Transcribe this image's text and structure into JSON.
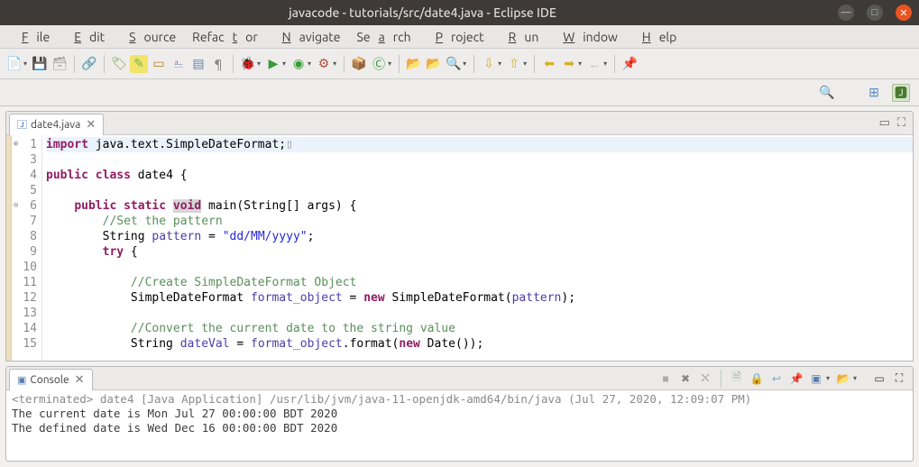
{
  "window": {
    "title": "javacode - tutorials/src/date4.java - Eclipse IDE"
  },
  "menu": {
    "file": "File",
    "edit": "Edit",
    "source": "Source",
    "refactor": "Refactor",
    "navigate": "Navigate",
    "search": "Search",
    "project": "Project",
    "run": "Run",
    "window": "Window",
    "help": "Help"
  },
  "editor": {
    "tab_filename": "date4.java",
    "tab_close": "✕",
    "gutter": {
      "l1": "1",
      "l3": "3",
      "l4": "4",
      "l5": "5",
      "l6": "6",
      "l7": "7",
      "l8": "8",
      "l9": "9",
      "l10": "10",
      "l11": "11",
      "l12": "12",
      "l13": "13",
      "l14": "14",
      "l15": "15"
    },
    "code": {
      "line1_import": "import",
      "line1_rest": " java.text.SimpleDateFormat;",
      "line1_box": "▯",
      "line3": "",
      "line4_public": "public",
      "line4_class": "class",
      "line4_rest": " date4 {",
      "line5": "",
      "line6_indent": "    ",
      "line6_public": "public",
      "line6_static": "static",
      "line6_void": "void",
      "line6_rest": " main(String[] args) {",
      "line7_indent": "        ",
      "line7_cm": "//Set the pattern",
      "line8_indent": "        ",
      "line8_a": "String ",
      "line8_var": "pattern",
      "line8_eq": " = ",
      "line8_str": "\"dd/MM/yyyy\"",
      "line8_end": ";",
      "line9_indent": "        ",
      "line9_try": "try",
      "line9_rest": " {",
      "line10": "",
      "line11_indent": "            ",
      "line11_cm": "//Create SimpleDateFormat Object",
      "line12_indent": "            ",
      "line12_a": "SimpleDateFormat ",
      "line12_var": "format_object",
      "line12_eq": " = ",
      "line12_new": "new",
      "line12_b": " SimpleDateFormat(",
      "line12_arg": "pattern",
      "line12_end": ");",
      "line13": "",
      "line14_indent": "            ",
      "line14_cm": "//Convert the current date to the string value",
      "line15_indent": "            ",
      "line15_a": "String ",
      "line15_var": "dateVal",
      "line15_eq": " = ",
      "line15_obj": "format_object",
      "line15_b": ".format(",
      "line15_new": "new",
      "line15_c": " Date());"
    }
  },
  "console": {
    "tab_label": "Console",
    "tab_close": "✕",
    "header_prefix": "<terminated>",
    "header_rest": " date4 [Java Application] /usr/lib/jvm/java-11-openjdk-amd64/bin/java (Jul 27, 2020, 12:09:07 PM)",
    "line1": "The current date is Mon Jul 27 00:00:00 BDT 2020",
    "line2": "The defined date is Wed Dec 16 00:00:00 BDT 2020"
  },
  "icons": {
    "minimize": "—",
    "maximize": "□",
    "close": "✕",
    "dropdown": "▾"
  }
}
